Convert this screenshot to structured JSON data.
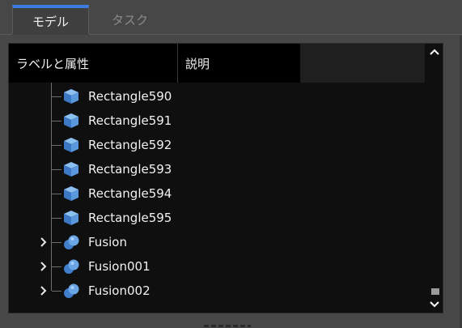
{
  "tabs": [
    {
      "label": "モデル",
      "active": true
    },
    {
      "label": "タスク",
      "active": false
    }
  ],
  "tree_view": {
    "columns": [
      "ラベルと属性",
      "説明"
    ],
    "items": [
      {
        "label": "Rectangle590",
        "icon": "cube-icon",
        "expandable": false
      },
      {
        "label": "Rectangle591",
        "icon": "cube-icon",
        "expandable": false
      },
      {
        "label": "Rectangle592",
        "icon": "cube-icon",
        "expandable": false
      },
      {
        "label": "Rectangle593",
        "icon": "cube-icon",
        "expandable": false
      },
      {
        "label": "Rectangle594",
        "icon": "cube-icon",
        "expandable": false
      },
      {
        "label": "Rectangle595",
        "icon": "cube-icon",
        "expandable": false
      },
      {
        "label": "Fusion",
        "icon": "fusion-icon",
        "expandable": true
      },
      {
        "label": "Fusion001",
        "icon": "fusion-icon",
        "expandable": true
      },
      {
        "label": "Fusion002",
        "icon": "fusion-icon",
        "expandable": true
      }
    ]
  },
  "colors": {
    "accent": "#3d7be2",
    "background": "#474747",
    "panel": "#0f0f0f",
    "cube": "#4f8fd6",
    "fusion": "#5a95d8"
  }
}
